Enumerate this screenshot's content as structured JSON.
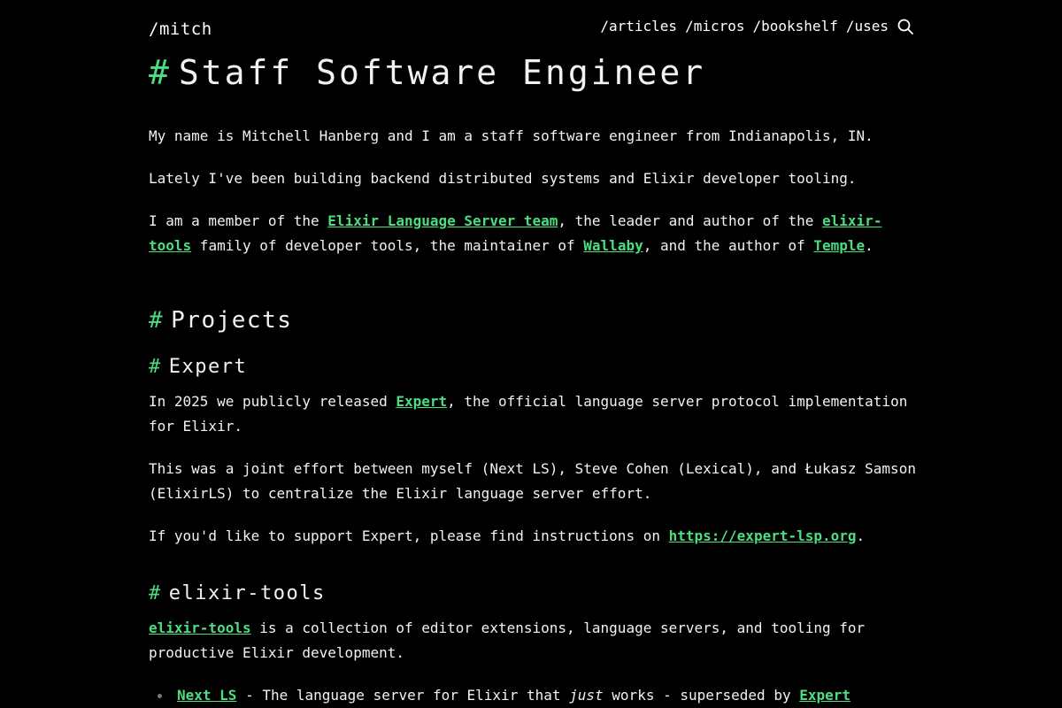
{
  "header": {
    "logo": "/mitch",
    "nav": [
      "/articles",
      "/micros",
      "/bookshelf",
      "/uses"
    ],
    "search_icon": "search-icon"
  },
  "intro": {
    "hash": "#",
    "title": "Staff Software Engineer",
    "p1": "My name is Mitchell Hanberg and I am a staff software engineer from Indianapolis, IN.",
    "p2": "Lately I've been building backend distributed systems and Elixir developer tooling.",
    "p3": {
      "t1": "I am a member of the ",
      "link1": "Elixir Language Server team",
      "t2": ", the leader and author of the ",
      "link2": "elixir-tools",
      "t3": " family of developer tools, the maintainer of ",
      "link3": "Wallaby",
      "t4": ", and the author of ",
      "link4": "Temple",
      "t5": "."
    }
  },
  "projects": {
    "title": "Projects",
    "expert": {
      "title": "Expert",
      "p1_t1": "In 2025 we publicly released ",
      "p1_link": "Expert",
      "p1_t2": ", the official language server protocol implementation for Elixir.",
      "p2": "This was a joint effort between myself (Next LS), Steve Cohen (Lexical), and Łukasz Samson (ElixirLS) to centralize the Elixir language server effort.",
      "p3_t1": "If you'd like to support Expert, please find instructions on ",
      "p3_link": "https://expert-lsp.org",
      "p3_t2": "."
    },
    "elixir_tools": {
      "title": "elixir-tools",
      "p1_link": "elixir-tools",
      "p1_t1": " is a collection of editor extensions, language servers, and tooling for productive Elixir development.",
      "items": [
        {
          "link": "Next LS",
          "t1": " - The language server for Elixir that ",
          "em": "just",
          "t2": " works - superseded by ",
          "link2": "Expert"
        }
      ]
    }
  },
  "colors": {
    "accent": "#4ade80",
    "background": "#000000",
    "text": "#f2f2f2"
  }
}
